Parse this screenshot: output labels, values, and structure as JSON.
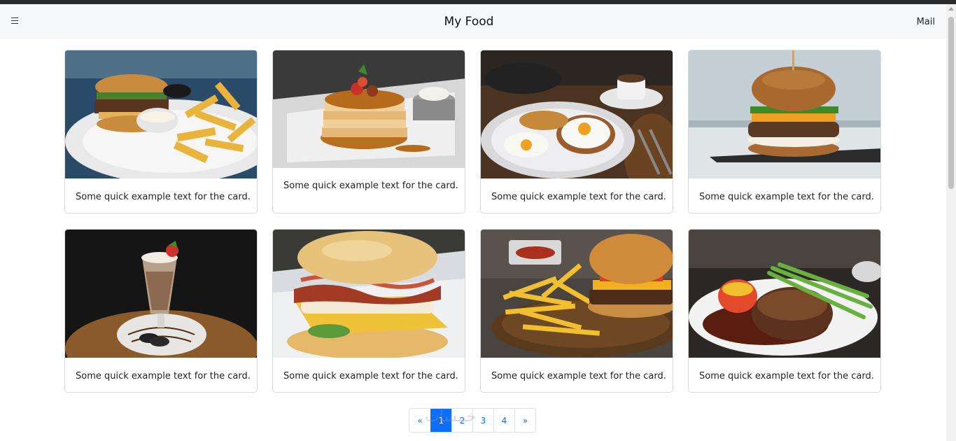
{
  "header": {
    "brand": "My Food",
    "right_link": "Mail"
  },
  "cards": [
    {
      "text": "Some quick example text for the card.",
      "image": "burger and fries plate"
    },
    {
      "text": "Some quick example text for the card.",
      "image": "pancake stack"
    },
    {
      "text": "Some quick example text for the card.",
      "image": "fried eggs breakfast"
    },
    {
      "text": "Some quick example text for the card.",
      "image": "burger on slate"
    },
    {
      "text": "Some quick example text for the card.",
      "image": "milkshake with cookies"
    },
    {
      "text": "Some quick example text for the card.",
      "image": "bacon egg biscuit sandwich"
    },
    {
      "text": "Some quick example text for the card.",
      "image": "burger with fries board"
    },
    {
      "text": "Some quick example text for the card.",
      "image": "steak with asparagus"
    }
  ],
  "pagination": {
    "prev": "«",
    "pages": [
      "1",
      "2",
      "3",
      "4"
    ],
    "active": "1",
    "next": "»"
  },
  "watermark": "خمسات",
  "colors": {
    "accent": "#0d6efd",
    "navbar_bg": "#f8f9fa"
  }
}
